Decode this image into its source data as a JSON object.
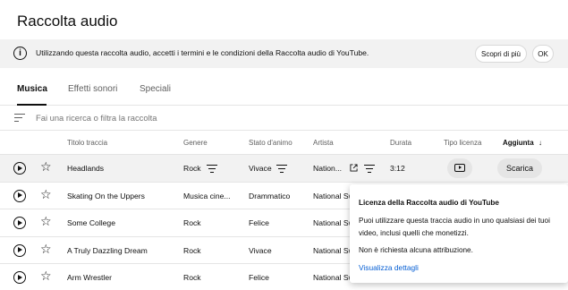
{
  "page": {
    "title": "Raccolta audio"
  },
  "banner": {
    "message": "Utilizzando questa raccolta audio, accetti i termini e le condizioni della Raccolta audio di YouTube.",
    "learn_more": "Scopri di più",
    "ok": "OK",
    "icon": "info-icon"
  },
  "tabs": [
    {
      "label": "Musica",
      "active": true
    },
    {
      "label": "Effetti sonori",
      "active": false
    },
    {
      "label": "Speciali",
      "active": false
    }
  ],
  "search": {
    "placeholder": "Fai una ricerca o filtra la raccolta",
    "icon": "filter-icon"
  },
  "table": {
    "headers": {
      "title": "Titolo traccia",
      "genre": "Genere",
      "mood": "Stato d'animo",
      "artist": "Artista",
      "duration": "Durata",
      "license": "Tipo licenza",
      "added": "Aggiunta",
      "sort_arrow": "↓"
    },
    "rows": [
      {
        "title": "Headlands",
        "genre": "Rock",
        "mood": "Vivace",
        "artist": "Nation...",
        "duration": "3:12",
        "download": "Scarica"
      },
      {
        "title": "Skating On the Uppers",
        "genre": "Musica cine...",
        "mood": "Drammatico",
        "artist": "National Sw"
      },
      {
        "title": "Some College",
        "genre": "Rock",
        "mood": "Felice",
        "artist": "National Sw"
      },
      {
        "title": "A Truly Dazzling Dream",
        "genre": "Rock",
        "mood": "Vivace",
        "artist": "National Sw"
      },
      {
        "title": "Arm Wrestler",
        "genre": "Rock",
        "mood": "Felice",
        "artist": "National Sw"
      }
    ]
  },
  "popup": {
    "title": "Licenza della Raccolta audio di YouTube",
    "body": "Puoi utilizzare questa traccia audio in uno qualsiasi dei tuoi video, inclusi quelli che monetizzi.",
    "note": "Non è richiesta alcuna attribuzione.",
    "link": "Visualizza dettagli"
  },
  "colors": {
    "accent_link": "#065fd4",
    "row_hover": "#f2f2f2",
    "banner_bg": "#f2f2f2"
  }
}
